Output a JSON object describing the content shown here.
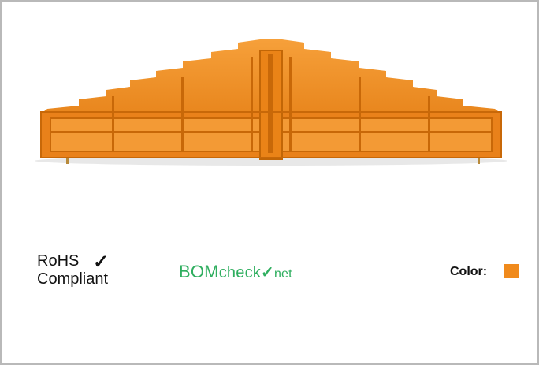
{
  "product": {
    "icon": "orange-terminal-block-end-plate",
    "color_hex": "#f08a1c"
  },
  "rohs": {
    "line1": "RoHS",
    "line2": "Compliant",
    "check": "✓"
  },
  "bomcheck": {
    "part1": "BOM",
    "part2": "check",
    "tick": "✓",
    "part3": "net"
  },
  "color": {
    "label": "Color:",
    "swatch": "#f08a1c"
  }
}
